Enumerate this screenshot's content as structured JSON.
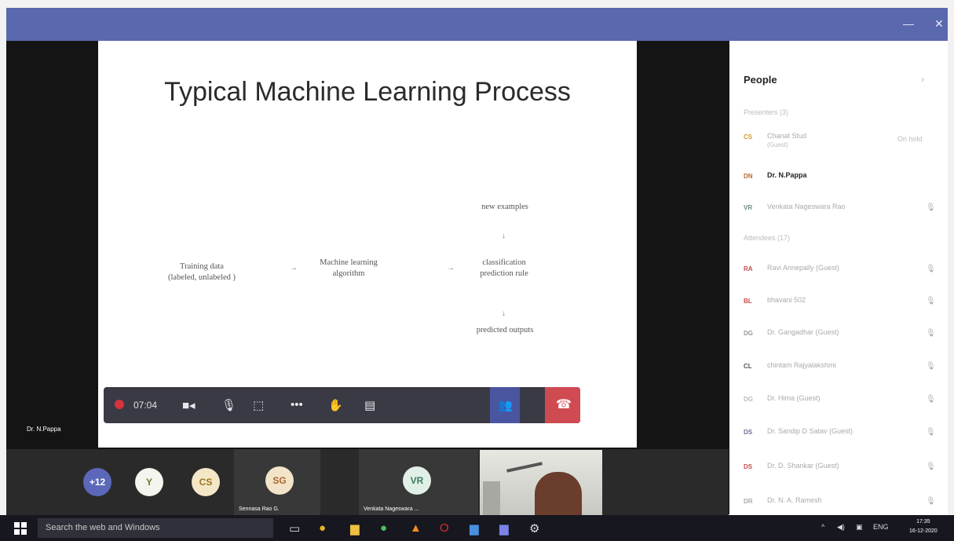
{
  "window": {
    "minimize_icon": "minimize-icon",
    "close_icon": "close-icon",
    "minimize_label": "—",
    "close_label": "✕"
  },
  "slide": {
    "title": "Typical Machine Learning Process",
    "box_training_1": "Training data",
    "box_training_2": "(labeled, unlabeled )",
    "box_algorithm_1": "Machine learning",
    "box_algorithm_2": "algorithm",
    "box_new": "new examples",
    "box_rule_1": "classification",
    "box_rule_2": "prediction rule",
    "box_output": "predicted outputs"
  },
  "call": {
    "timer": "07:04",
    "presenter_label": "Dr. N.Pappa",
    "colors": {
      "record": "#d7333c",
      "hangup": "#d04a52",
      "active": "#4a55a0"
    }
  },
  "participants_strip": {
    "more_count": "+12",
    "avatars": [
      {
        "initials": "Y"
      },
      {
        "initials": "CS"
      }
    ],
    "tiles": [
      {
        "initials": "SG",
        "name": "Sennasa Rao G."
      },
      {
        "initials": "VR",
        "name": "Venkata Nageswara ..."
      }
    ]
  },
  "people": {
    "title": "People",
    "presenters_label": "Presenters (3)",
    "attendees_label": "Attendees (17)",
    "presenters": [
      {
        "initials": "CS",
        "name": "Chanat Stud",
        "name2": "(Guest)",
        "role": "On hold",
        "color": "#d59a2f"
      },
      {
        "initials": "DN",
        "name": "Dr. N.Pappa",
        "bold": true,
        "color": "#b96a2e"
      },
      {
        "initials": "VR",
        "name": "Venkata Nageswara Rao",
        "color": "#6b8f7a"
      }
    ],
    "attendees": [
      {
        "initials": "RA",
        "name": "Ravi Annepally (Guest)",
        "color": "#c94a4a"
      },
      {
        "initials": "BL",
        "name": "bhavani 502",
        "color": "#c94a4a"
      },
      {
        "initials": "DG",
        "name": "Dr. Gangadhar (Guest)",
        "color": "#999999"
      },
      {
        "initials": "CL",
        "name": "chintam Rajyalakshmi",
        "color": "#555555"
      },
      {
        "initials": "DG",
        "name": "Dr. Hima (Guest)",
        "color": "#bbbbbb"
      },
      {
        "initials": "DS",
        "name": "Dr. Sandip D Satav (Guest)",
        "color": "#7a6a9a"
      },
      {
        "initials": "DS",
        "name": "Dr. D. Shankar (Guest)",
        "color": "#c94a4a"
      },
      {
        "initials": "DR",
        "name": "Dr. N. A. Ramesh",
        "color": "#aaaaaa"
      }
    ]
  },
  "taskbar": {
    "search_placeholder": "Search the web and Windows",
    "lang": "ENG",
    "time": "17:35",
    "date": "16-12-2020"
  }
}
